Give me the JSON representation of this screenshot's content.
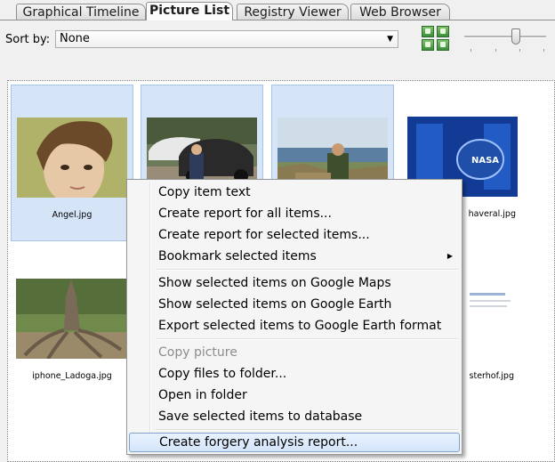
{
  "tabs": [
    {
      "label": "Graphical Timeline",
      "active": false
    },
    {
      "label": "Picture List",
      "active": true
    },
    {
      "label": "Registry Viewer",
      "active": false
    },
    {
      "label": "Web Browser",
      "active": false
    }
  ],
  "toolbar": {
    "sort_label": "Sort by:",
    "sort_value": "None",
    "zoom_level": 0.63
  },
  "pictures": [
    {
      "filename": "Angel.jpg",
      "selected": true
    },
    {
      "filename": "",
      "selected": true
    },
    {
      "filename": "",
      "selected": true
    },
    {
      "filename": "haveral.jpg",
      "selected": false
    },
    {
      "filename": "iphone_Ladoga.jpg",
      "selected": false
    },
    {
      "filename": "",
      "selected": false
    },
    {
      "filename": "",
      "selected": false
    },
    {
      "filename": "sterhof.jpg",
      "selected": false
    }
  ],
  "context_menu": {
    "items": [
      {
        "label": "Copy item text",
        "disabled": false
      },
      {
        "label": "Create report for all items...",
        "disabled": false
      },
      {
        "label": "Create report for selected items...",
        "disabled": false
      },
      {
        "label": "Bookmark selected items",
        "disabled": false
      },
      {
        "label": "Show selected items on Google Maps",
        "disabled": false
      },
      {
        "label": "Show selected items on Google Earth",
        "disabled": false
      },
      {
        "label": "Export selected items to Google Earth format",
        "disabled": false
      },
      {
        "label": "Copy picture",
        "disabled": true
      },
      {
        "label": "Copy files to folder...",
        "disabled": false
      },
      {
        "label": "Open in folder",
        "disabled": false
      },
      {
        "label": "Save selected items to database",
        "disabled": false
      },
      {
        "label": "Create forgery analysis report...",
        "disabled": false,
        "highlighted": true
      }
    ]
  },
  "colors": {
    "selection_bg": "#d6e4f7",
    "menu_highlight": "#d3e5fb"
  },
  "icons": [
    "dropdown-arrow-icon",
    "view-mode-icon",
    "submenu-arrow-icon"
  ]
}
